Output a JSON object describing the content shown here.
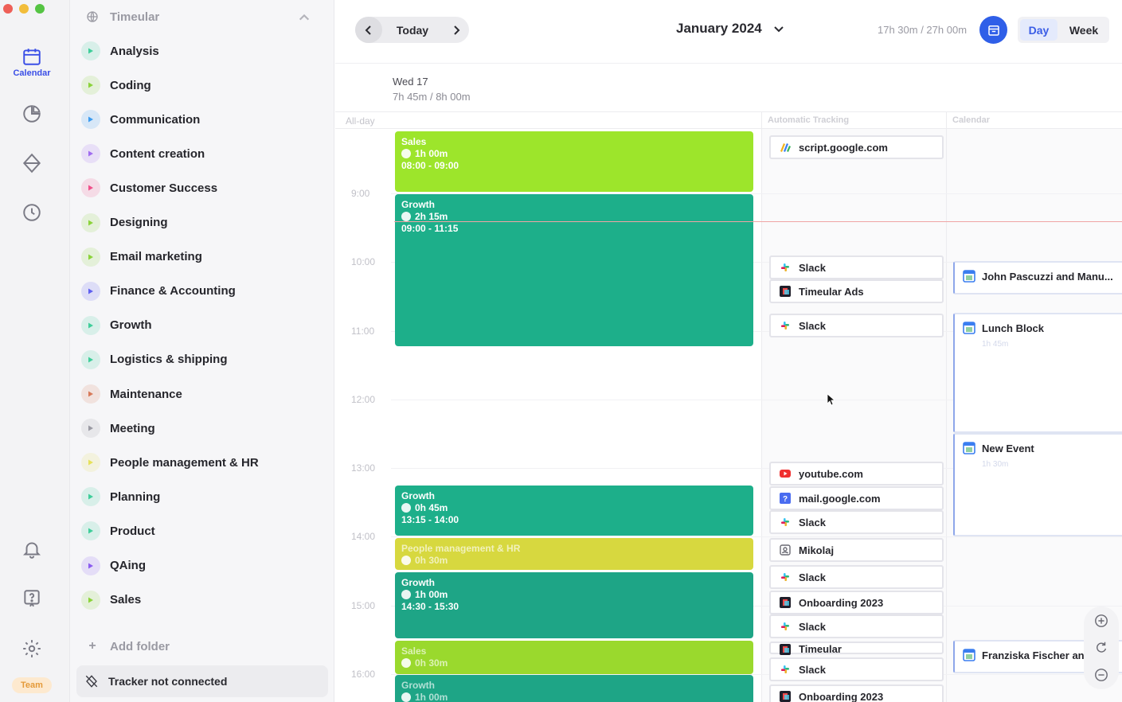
{
  "app": {
    "rail": {
      "calendar_label": "Calendar",
      "team_badge": "Team"
    },
    "sidebar": {
      "workspace": "Timeular",
      "activities": [
        {
          "label": "Analysis",
          "color": "#3fce9a"
        },
        {
          "label": "Coding",
          "color": "#8bd33a"
        },
        {
          "label": "Communication",
          "color": "#3b9cf0"
        },
        {
          "label": "Content creation",
          "color": "#a06cf0"
        },
        {
          "label": "Customer Success",
          "color": "#f0508a"
        },
        {
          "label": "Designing",
          "color": "#8bd33a"
        },
        {
          "label": "Email marketing",
          "color": "#8bd33a"
        },
        {
          "label": "Finance & Accounting",
          "color": "#5f60f0"
        },
        {
          "label": "Growth",
          "color": "#3fce9a"
        },
        {
          "label": "Logistics & shipping",
          "color": "#3fce9a"
        },
        {
          "label": "Maintenance",
          "color": "#d77a5a"
        },
        {
          "label": "Meeting",
          "color": "#9a9aa3"
        },
        {
          "label": "People management & HR",
          "color": "#e6e15a"
        },
        {
          "label": "Planning",
          "color": "#3fce9a"
        },
        {
          "label": "Product",
          "color": "#3fce9a"
        },
        {
          "label": "QAing",
          "color": "#8b5cf0"
        },
        {
          "label": "Sales",
          "color": "#8bd33a"
        }
      ],
      "add_folder": "Add folder",
      "tracker_status": "Tracker not connected"
    },
    "header": {
      "today": "Today",
      "month": "January 2024",
      "tracked_total": "17h 30m / 27h 00m",
      "view_day": "Day",
      "view_week": "Week"
    },
    "day": {
      "date": "Wed 17",
      "tracked": "7h 45m / 8h 00m",
      "allday_label": "All-day",
      "col_automatic": "Automatic Tracking",
      "col_calendar": "Calendar"
    },
    "time_labels": [
      "9:00",
      "10:00",
      "11:00",
      "12:00",
      "13:00",
      "14:00",
      "15:00",
      "16:00"
    ],
    "events": [
      {
        "title": "Sales",
        "duration": "1h 00m",
        "range": "08:00 - 09:00",
        "color": "#9de52b"
      },
      {
        "title": "Growth",
        "duration": "2h 15m",
        "range": "09:00 - 11:15",
        "color": "#1daf8a"
      },
      {
        "title": "Growth",
        "duration": "0h 45m",
        "range": "13:15 - 14:00",
        "color": "#1daf8a"
      },
      {
        "title": "People management & HR",
        "duration": "0h 30m",
        "range": "",
        "color": "#d7d83f"
      },
      {
        "title": "Growth",
        "duration": "1h 00m",
        "range": "14:30 - 15:30",
        "color": "#1ea586"
      },
      {
        "title": "Sales",
        "duration": "0h 30m",
        "range": "",
        "color": "#9ad92d"
      },
      {
        "title": "Growth",
        "duration": "1h 00m",
        "range": "",
        "color": "#1ea586"
      }
    ],
    "tracking": [
      {
        "label": "script.google.com",
        "icon": "google-script-icon"
      },
      {
        "label": "Slack",
        "icon": "slack-icon"
      },
      {
        "label": "Timeular Ads",
        "icon": "app-icon"
      },
      {
        "label": "Slack",
        "icon": "slack-icon"
      },
      {
        "label": "youtube.com",
        "icon": "youtube-icon"
      },
      {
        "label": "mail.google.com",
        "icon": "help-square-icon"
      },
      {
        "label": "Slack",
        "icon": "slack-icon"
      },
      {
        "label": "Mikolaj",
        "icon": "contact-icon"
      },
      {
        "label": "Slack",
        "icon": "slack-icon"
      },
      {
        "label": "Onboarding 2023",
        "icon": "app-icon"
      },
      {
        "label": "Slack",
        "icon": "slack-icon"
      },
      {
        "label": "Timeular",
        "icon": "app-icon"
      },
      {
        "label": "Slack",
        "icon": "slack-icon"
      },
      {
        "label": "Onboarding 2023",
        "icon": "app-icon"
      }
    ],
    "calendar_events": [
      {
        "title": "John Pascuzzi and Manu...",
        "sub": ""
      },
      {
        "title": "Lunch Block",
        "sub": "1h 45m"
      },
      {
        "title": "New Event",
        "sub": "1h 30m"
      },
      {
        "title": "Franziska Fischer an",
        "sub": ""
      }
    ]
  }
}
